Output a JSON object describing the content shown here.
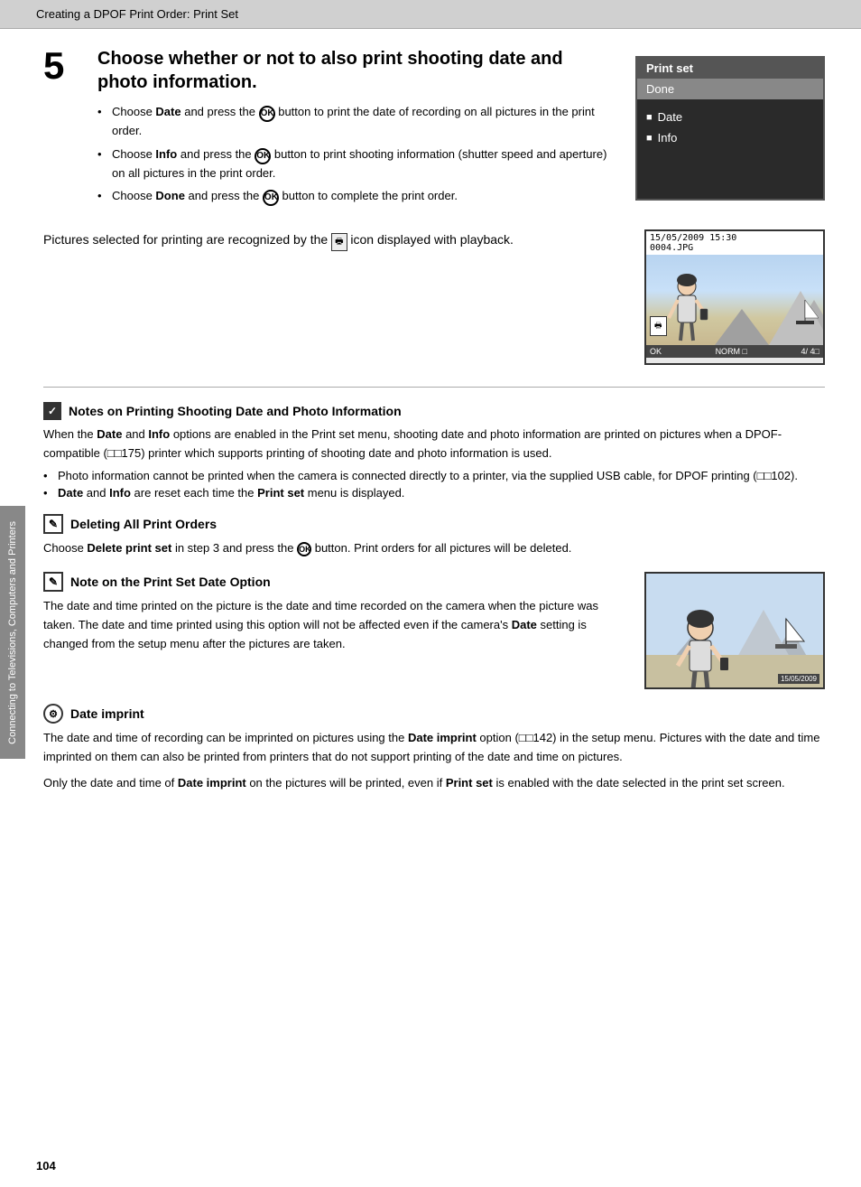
{
  "header": {
    "title": "Creating a DPOF Print Order: Print Set"
  },
  "side_tab": {
    "text": "Connecting to Televisions, Computers and Printers"
  },
  "step": {
    "number": "5",
    "title": "Choose whether or not to also print shooting date and photo information.",
    "bullets": [
      {
        "text_before": "Choose ",
        "bold": "Date",
        "text_after": " and press the  button to print the date of recording on all pictures in the print order."
      },
      {
        "text_before": "Choose ",
        "bold": "Info",
        "text_after": " and press the  button to print shooting information (shutter speed and aperture) on all pictures in the print order."
      },
      {
        "text_before": "Choose ",
        "bold": "Done",
        "text_after": " and press the  button to complete the print order."
      }
    ]
  },
  "camera_ui": {
    "title": "Print set",
    "items": [
      {
        "label": "Done",
        "selected": true,
        "checked": false
      },
      {
        "label": "",
        "divider": true
      },
      {
        "label": "Date",
        "checked": true
      },
      {
        "label": "Info",
        "checked": true
      }
    ]
  },
  "playback": {
    "text": "Pictures selected for printing are recognized by the   icon displayed with playback.",
    "image": {
      "header": "15/05/2009 15:30\n0004.JPG",
      "footer_left": "OK",
      "footer_right": "4/  4"
    }
  },
  "notes": {
    "shooting_date": {
      "title": "Notes on Printing Shooting Date and Photo Information",
      "body": "When the  Date  and  Info  options are enabled in the Print set menu, shooting date and photo information are printed on pictures when a DPOF-compatible (  175) printer which supports printing of shooting date and photo information is used.",
      "bullets": [
        "Photo information cannot be printed when the camera is connected directly to a printer, via the supplied USB cable, for DPOF printing (  102).",
        " Date  and  Info  are reset each time the  Print set  menu is displayed."
      ]
    },
    "deleting": {
      "title": "Deleting All Print Orders",
      "body": "Choose  Delete print set  in step 3 and press the   button. Print orders for all pictures will be deleted."
    },
    "print_set_date": {
      "title": "Note on the Print Set Date Option",
      "body": "The date and time printed on the picture is the date and time recorded on the camera when the picture was taken. The date and time printed using this option will not be affected even if the camera's  Date  setting is changed from the setup menu after the pictures are taken."
    },
    "date_imprint": {
      "title": "Date imprint",
      "body_before": "The date and time of recording can be imprinted on pictures using the ",
      "bold": "Date imprint",
      "body_middle": " option (  142) in the setup menu. Pictures with the date and time imprinted on them can also be printed from printers that do not support printing of the date and time on pictures.",
      "body_after": "Only the date and time of  Date imprint  on the pictures will be printed, even if  Print set  is enabled with the date selected in the print set screen."
    }
  },
  "page_number": "104"
}
